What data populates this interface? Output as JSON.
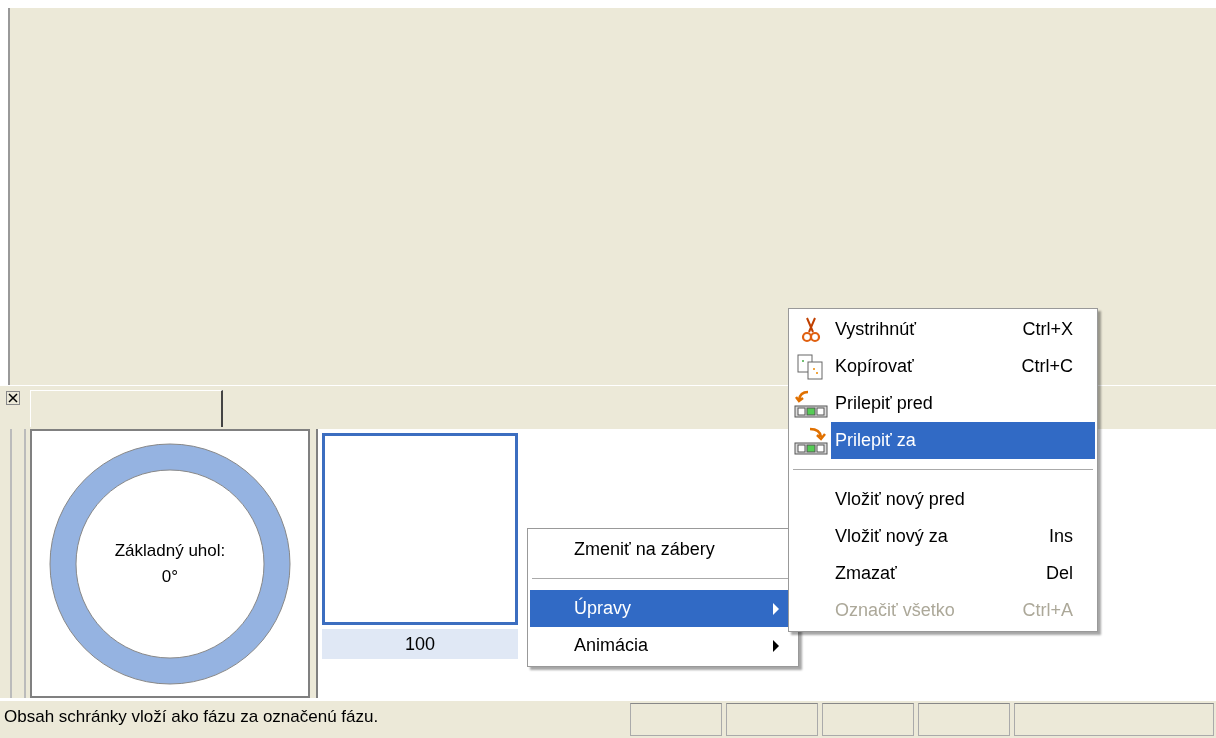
{
  "angle_dial": {
    "label": "Základný uhol:",
    "value": "0°"
  },
  "frames": [
    {
      "label": "100",
      "selected": true
    }
  ],
  "context_menu": {
    "items": [
      {
        "kind": "command",
        "label": "Zmeniť na zábery",
        "selected": false
      },
      {
        "kind": "separator"
      },
      {
        "kind": "submenu",
        "label": "Úpravy",
        "selected": true
      },
      {
        "kind": "submenu",
        "label": "Animácia",
        "selected": false
      }
    ]
  },
  "submenu": {
    "items": [
      {
        "kind": "command",
        "label": "Vystrihnúť",
        "shortcut": "Ctrl+X",
        "selected": false,
        "disabled": false
      },
      {
        "kind": "command",
        "label": "Kopírovať",
        "shortcut": "Ctrl+C",
        "selected": false,
        "disabled": false
      },
      {
        "kind": "command",
        "label": "Prilepiť pred",
        "selected": false,
        "disabled": false
      },
      {
        "kind": "command",
        "label": "Prilepiť za",
        "selected": true,
        "disabled": false
      },
      {
        "kind": "separator"
      },
      {
        "kind": "command",
        "label": "Vložiť nový pred",
        "selected": false,
        "disabled": false
      },
      {
        "kind": "command",
        "label": "Vložiť nový za",
        "shortcut": "Ins",
        "selected": false,
        "disabled": false
      },
      {
        "kind": "command",
        "label": "Zmazať",
        "shortcut": "Del",
        "selected": false,
        "disabled": false
      },
      {
        "kind": "command",
        "label": "Označiť všetko",
        "shortcut": "Ctrl+A",
        "selected": false,
        "disabled": true
      }
    ]
  },
  "status_bar": {
    "message": "Obsah schránky vloží ako fázu za označenú fázu."
  }
}
